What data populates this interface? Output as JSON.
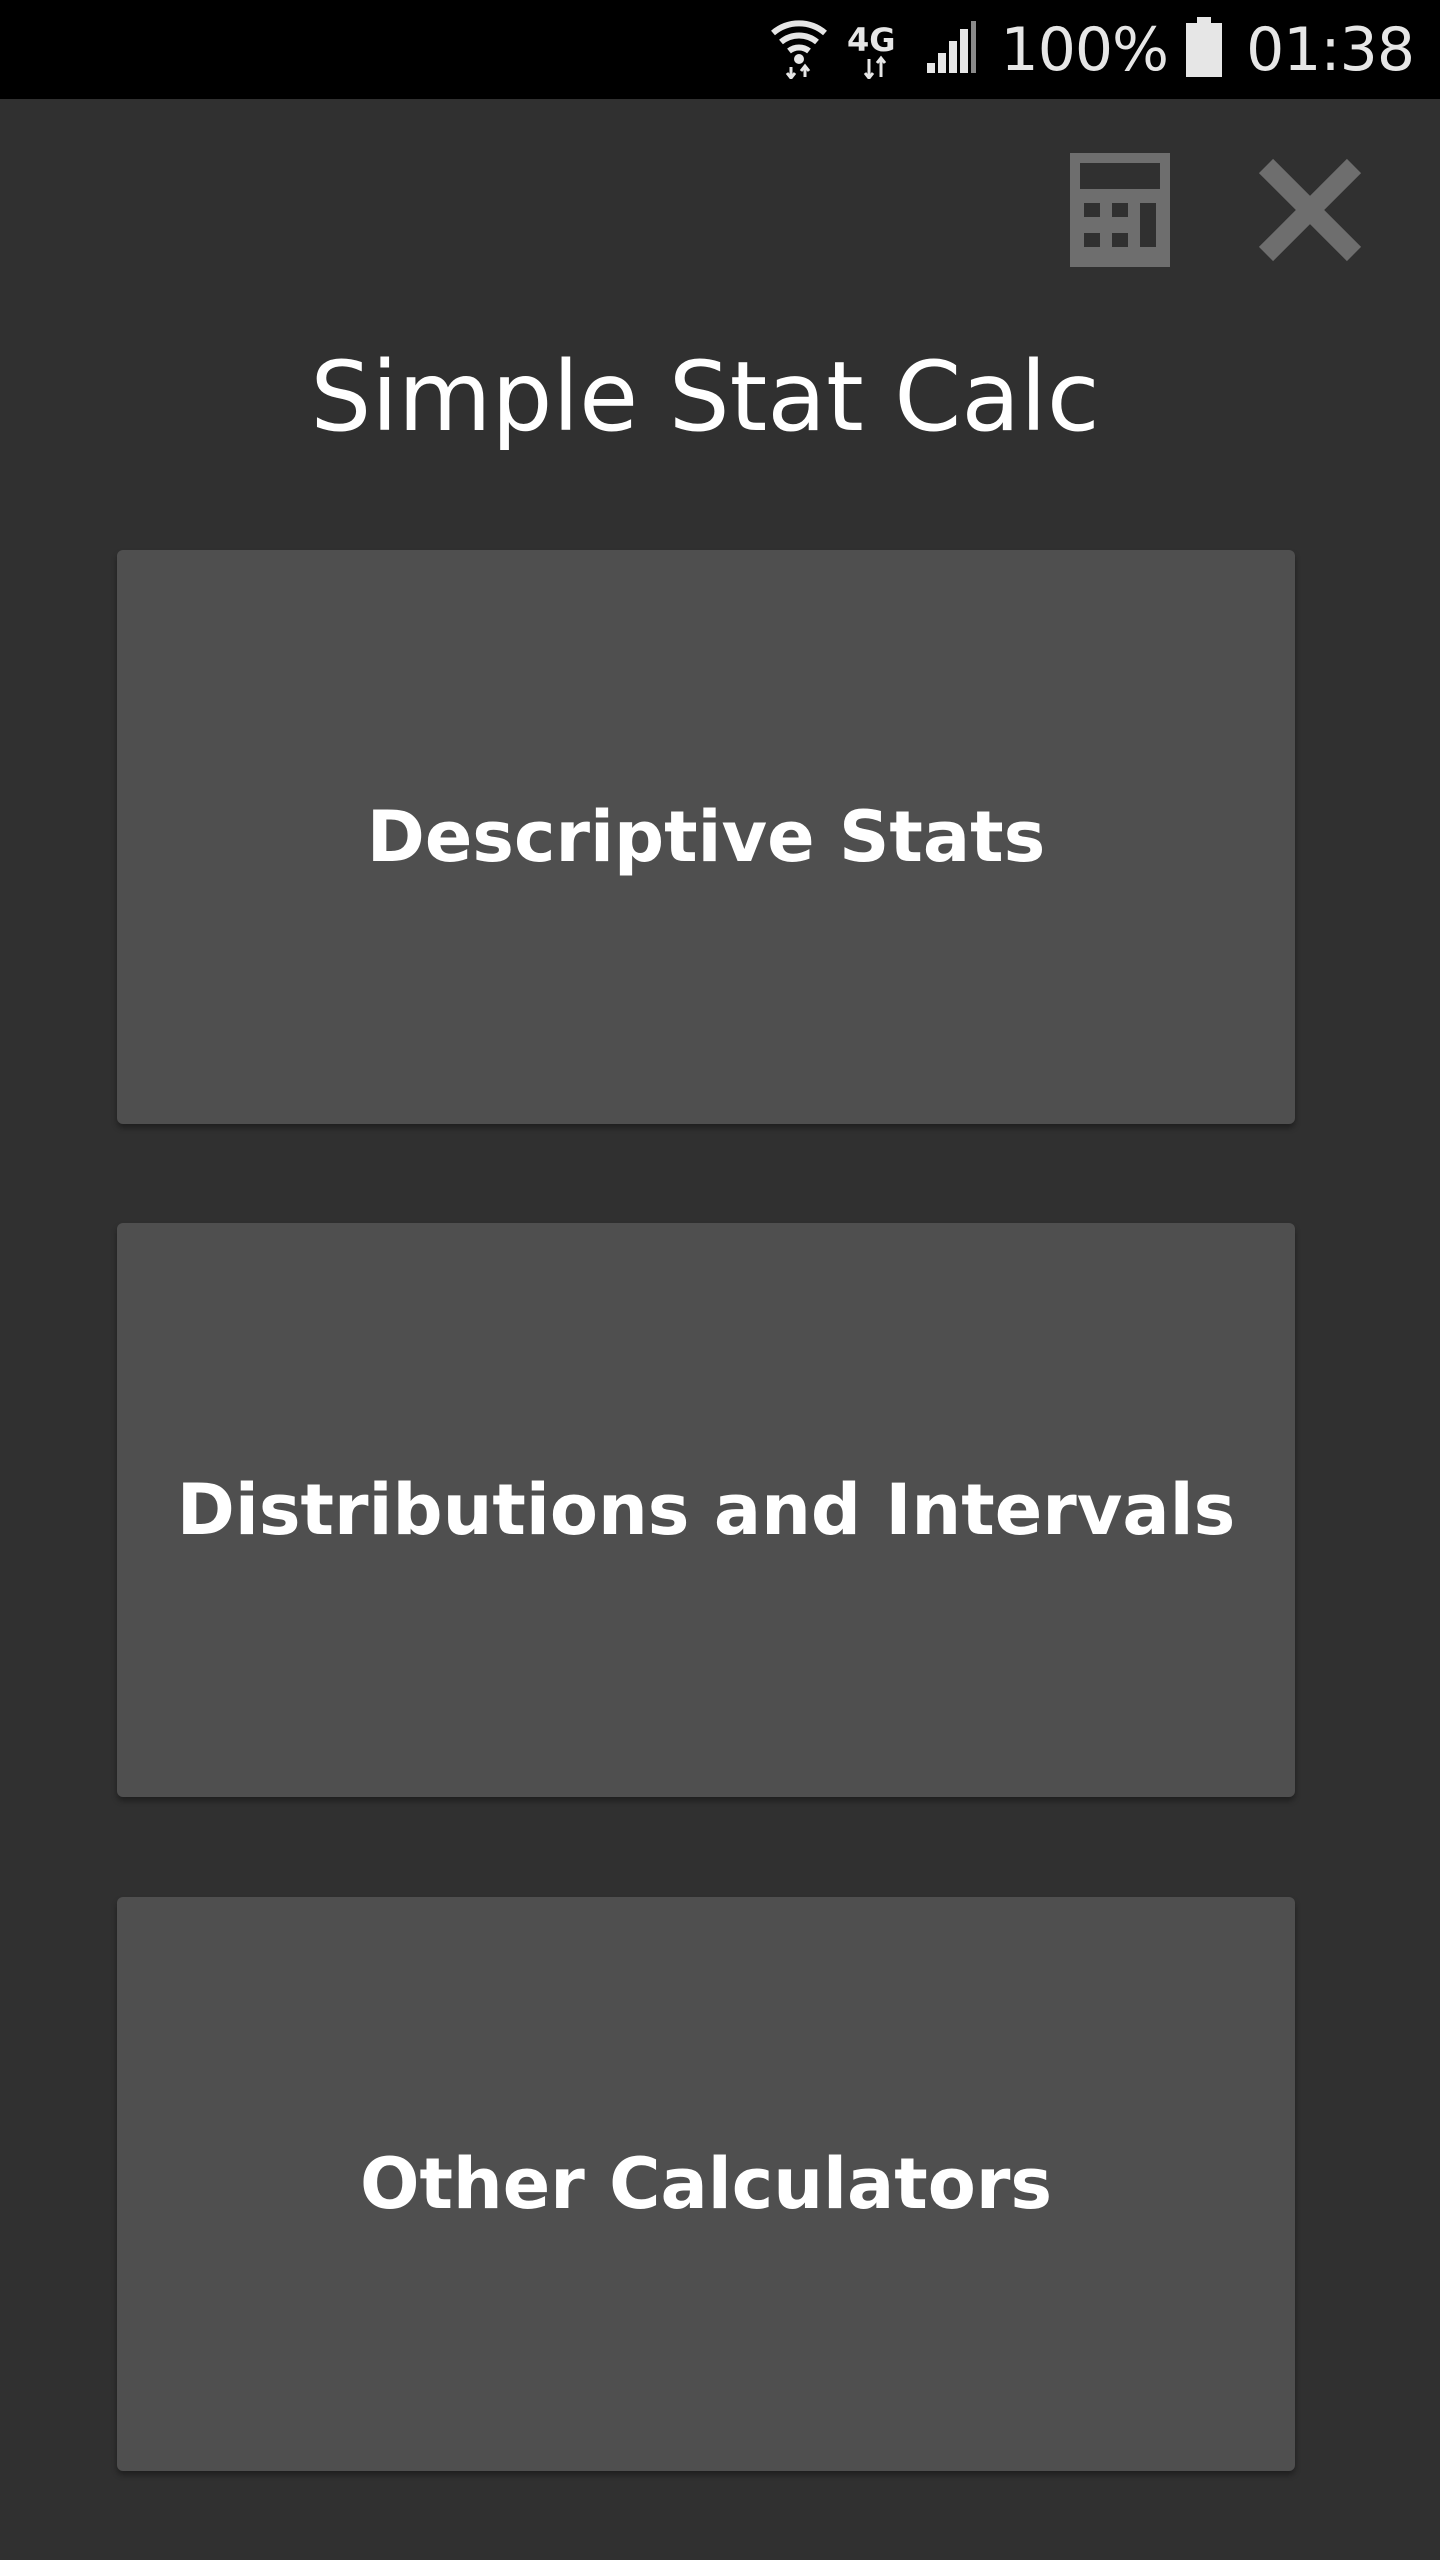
{
  "status_bar": {
    "battery_text": "100%",
    "time": "01:38",
    "icons": [
      "wifi-icon",
      "4g-lte-icon",
      "signal-icon",
      "battery-icon"
    ],
    "network_label": "4G"
  },
  "toolbar": {
    "calculator_icon": "calculator-icon",
    "close_icon": "close-icon"
  },
  "app": {
    "title": "Simple Stat Calc"
  },
  "menu": {
    "items": [
      {
        "label": "Descriptive Stats"
      },
      {
        "label": "Distributions and Intervals"
      },
      {
        "label": "Other Calculators"
      }
    ]
  },
  "colors": {
    "background": "#303030",
    "card": "#4f4f4f",
    "status_bar": "#000000",
    "icon_gray": "#6e6e6e",
    "text": "#ffffff"
  }
}
